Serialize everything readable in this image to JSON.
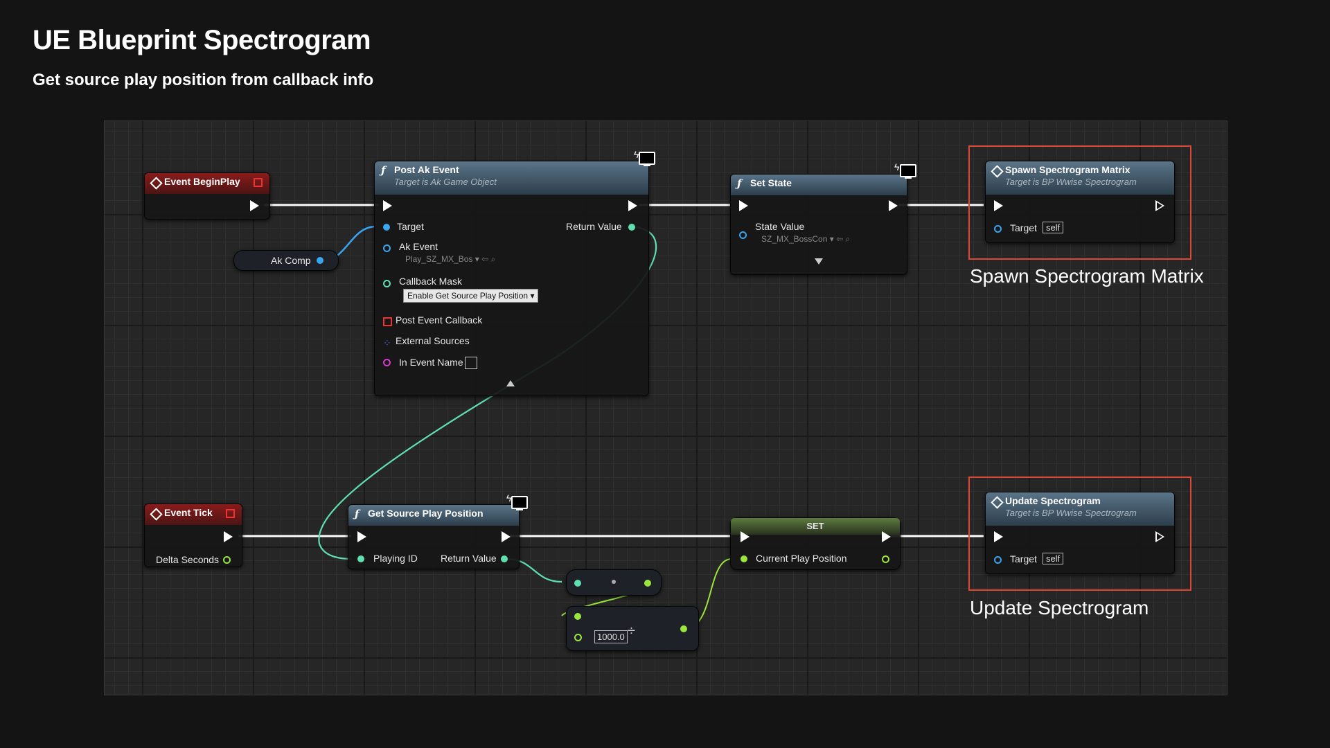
{
  "page": {
    "title": "UE Blueprint Spectrogram",
    "subtitle": "Get source play position from callback info"
  },
  "nodes": {
    "event_begin_play": {
      "title": "Event BeginPlay"
    },
    "ak_comp": {
      "label": "Ak Comp"
    },
    "post_ak_event": {
      "title": "Post Ak Event",
      "subtitle": "Target is Ak Game Object",
      "target_label": "Target",
      "return_label": "Return Value",
      "ak_event_label": "Ak Event",
      "ak_event_value": "Play_SZ_MX_Bos",
      "callback_mask_label": "Callback Mask",
      "callback_mask_value": "Enable Get Source Play Position",
      "post_event_callback_label": "Post Event Callback",
      "external_sources_label": "External Sources",
      "in_event_name_label": "In Event Name"
    },
    "set_state": {
      "title": "Set State",
      "state_value_label": "State Value",
      "state_value": "SZ_MX_BossCon"
    },
    "spawn_spectrogram_matrix": {
      "title": "Spawn Spectrogram Matrix",
      "subtitle": "Target is BP Wwise Spectrogram",
      "target_label": "Target",
      "target_value": "self"
    },
    "event_tick": {
      "title": "Event Tick",
      "delta_label": "Delta Seconds"
    },
    "get_source_play_position": {
      "title": "Get Source Play Position",
      "playing_id_label": "Playing ID",
      "return_label": "Return Value"
    },
    "divide": {
      "value": "1000.0",
      "symbol": "÷"
    },
    "set_node": {
      "title": "SET",
      "current_play_position_label": "Current Play Position"
    },
    "update_spectrogram": {
      "title": "Update Spectrogram",
      "subtitle": "Target is BP Wwise Spectrogram",
      "target_label": "Target",
      "target_value": "self"
    }
  },
  "annotations": {
    "spawn": "Spawn Spectrogram Matrix",
    "update": "Update Spectrogram"
  },
  "colors": {
    "exec": "#ffffff",
    "object_pin": "#3aa6ef",
    "int_pin": "#5fe0b0",
    "float_pin": "#9be63c",
    "highlight": "#e04535"
  },
  "icons": [
    "event-diamond-icon",
    "function-icon",
    "delegate-icon",
    "monitor-icon",
    "collapse-arrow-icon",
    "expand-arrow-icon",
    "array-icon"
  ]
}
